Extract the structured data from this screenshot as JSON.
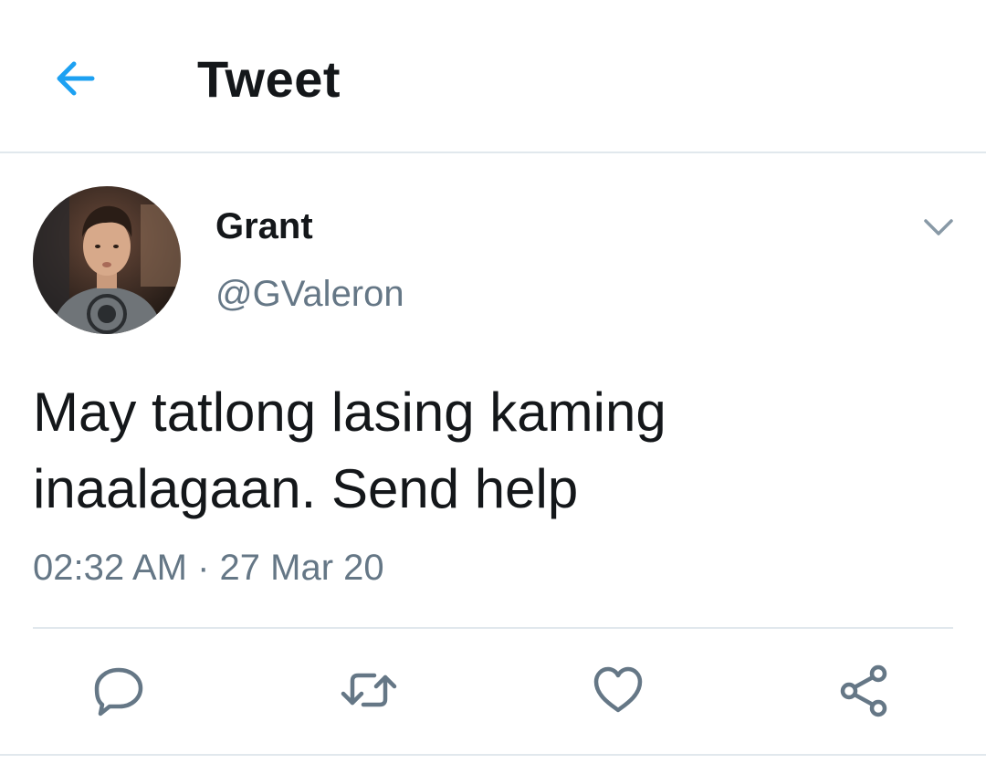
{
  "header": {
    "title": "Tweet",
    "back_icon": "arrow-left-icon",
    "accent_color": "#1da1f2"
  },
  "author": {
    "display_name": "Grant",
    "handle": "@GValeron",
    "avatar_icon": "profile-photo"
  },
  "tweet": {
    "text_line1": "May tatlong lasing kaming",
    "text_line2": "inaalagaan. Send help",
    "timestamp": "02:32 AM · 27 Mar 20"
  },
  "actions": [
    {
      "icon": "reply-icon"
    },
    {
      "icon": "retweet-icon"
    },
    {
      "icon": "like-icon"
    },
    {
      "icon": "share-icon"
    }
  ],
  "colors": {
    "text_primary": "#14171a",
    "text_secondary": "#657786",
    "icon_gray": "#657786",
    "divider": "#e1e8ed"
  }
}
